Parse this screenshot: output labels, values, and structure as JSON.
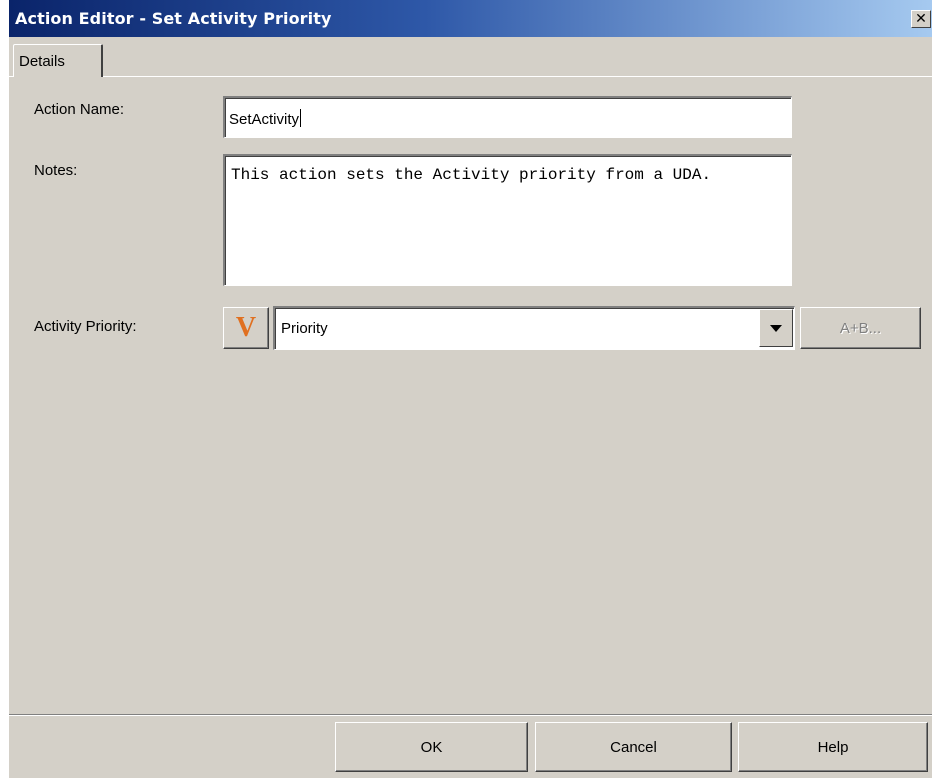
{
  "window": {
    "title": "Action Editor - Set Activity Priority",
    "close_glyph": "✕"
  },
  "tabs": [
    {
      "label": "Details",
      "selected": true
    }
  ],
  "form": {
    "action_name_label": "Action Name:",
    "action_name_value": "SetActivity",
    "notes_label": "Notes:",
    "notes_value": "This action sets the Activity priority from a UDA.",
    "activity_priority_label": "Activity Priority:",
    "variable_button_glyph": "V",
    "variable_icon_color": "#e07020",
    "activity_priority_value": "Priority",
    "expression_button_label": "A+B..."
  },
  "footer": {
    "ok_label": "OK",
    "cancel_label": "Cancel",
    "help_label": "Help"
  },
  "colors": {
    "titlebar_start": "#0a246a",
    "titlebar_end": "#a6caf0",
    "dialog_face": "#d4d0c8"
  }
}
